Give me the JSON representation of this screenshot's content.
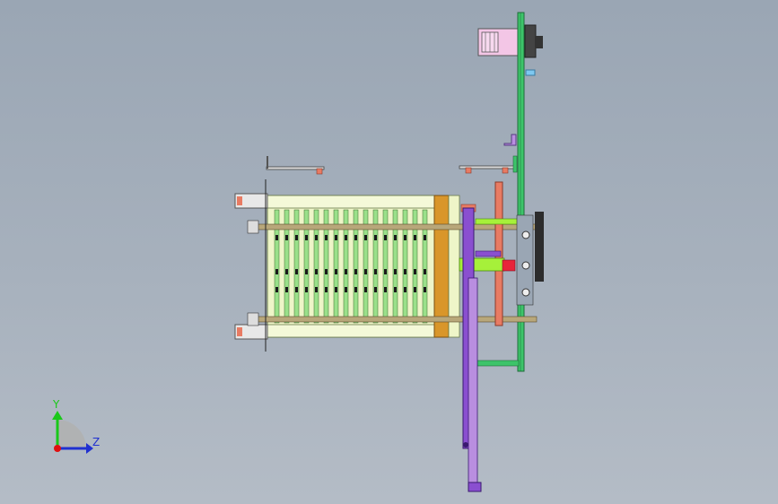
{
  "viewport": {
    "background_top": "#9aa6b4",
    "background_bottom": "#b4bcc6"
  },
  "triad": {
    "y_label": "Y",
    "z_label": "Z",
    "y_color": "#19c819",
    "z_color": "#2030d0",
    "x_color": "#e01010"
  },
  "colors": {
    "frame_green": "#3dc46a",
    "plate_light": "#eef5c8",
    "plate_edge": "#8a9a5a",
    "slot_green": "#9ae08a",
    "orange": "#d9962a",
    "salmon": "#e87b63",
    "purple": "#8a4fd0",
    "rod": "#b8a77a",
    "motor_pink": "#f3c6e6",
    "motor_dark": "#2c2c2c",
    "bracket_gray": "#c8c8c8",
    "lime": "#a6f03a",
    "red": "#e8243a",
    "cyan": "#7ec8f0"
  }
}
